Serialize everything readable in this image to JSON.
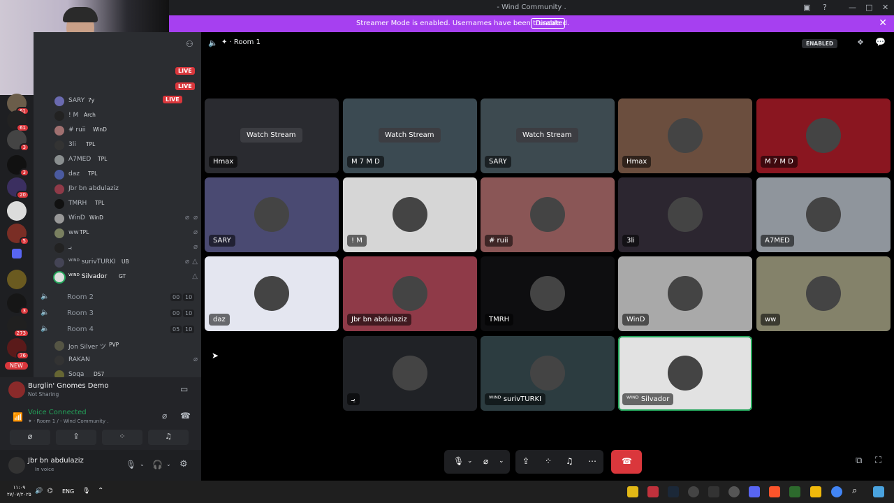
{
  "window": {
    "title": "- Wind Community .",
    "controls": [
      "—",
      "□",
      "✕"
    ]
  },
  "banner": {
    "message": "Streamer Mode is enabled. Usernames have been truncated.",
    "disable_label": "Disable",
    "close": "✕"
  },
  "servers": [
    {
      "badge": "61"
    },
    {
      "badge": "3"
    },
    {
      "badge": "3"
    },
    {
      "badge": "20"
    },
    {
      "badge": ""
    },
    {
      "badge": "5"
    },
    {
      "badge": ""
    },
    {
      "badge": ""
    },
    {
      "badge": "3"
    },
    {
      "badge": "273"
    },
    {
      "badge": "76"
    }
  ],
  "new_badge": "NEW",
  "sidebar": {
    "live_labels": [
      "LIVE",
      "LIVE",
      "LIVE"
    ],
    "room1_users": [
      {
        "name": "SARY",
        "tag": "7y",
        "icons": [
          "⌀",
          ""
        ],
        "live": true
      },
      {
        "name": "! M",
        "tag": "Arch",
        "icons": [
          "",
          ""
        ]
      },
      {
        "name": "# ruii",
        "tag": "WinD",
        "icons": [
          "",
          ""
        ]
      },
      {
        "name": "3li",
        "tag": "TPL",
        "icons": [
          "",
          ""
        ]
      },
      {
        "name": "A7MED",
        "tag": "TPL",
        "icons": [
          "",
          ""
        ]
      },
      {
        "name": "daz",
        "tag": "TPL",
        "icons": [
          "",
          ""
        ]
      },
      {
        "name": "Jbr bn abdulaziz",
        "tag": "",
        "icons": [
          "",
          ""
        ]
      },
      {
        "name": "TMRH",
        "tag": "TPL",
        "icons": [
          "",
          ""
        ]
      },
      {
        "name": "WinD",
        "tag": "WinD",
        "icons": [
          "⌀",
          "⌀"
        ]
      },
      {
        "name": "ww",
        "tag": "TPL",
        "icons": [
          "",
          "⌀"
        ]
      },
      {
        "name": "يـ",
        "tag": "",
        "icons": [
          "",
          "⌀"
        ]
      },
      {
        "name": "ᵂᴵᴺᴰ surivTURKI",
        "tag": "UB",
        "icons": [
          "⌀",
          "△"
        ]
      },
      {
        "name": "ᵂᴵᴺᴰ Silvador",
        "tag": "GT",
        "icons": [
          "",
          "△"
        ]
      }
    ],
    "rooms": [
      {
        "name": "Room 2",
        "count_a": "00",
        "count_b": "10"
      },
      {
        "name": "Room 3",
        "count_a": "00",
        "count_b": "10"
      },
      {
        "name": "Room 4",
        "count_a": "05",
        "count_b": "10"
      }
    ],
    "room4_users": [
      {
        "name": "Jon Silver ツ",
        "tag": "PVP"
      },
      {
        "name": "RAKAN",
        "tag": ""
      },
      {
        "name": "Soqa",
        "tag": "DS7"
      }
    ]
  },
  "activity": {
    "game": "Burglin' Gnomes Demo",
    "status": "Not Sharing",
    "voice_connected": "Voice Connected",
    "voice_location": "✦ · Room 1 / - Wind Community ."
  },
  "user": {
    "name": "Jbr bn abdulaziz",
    "status": "In voice"
  },
  "main": {
    "room_title": "✦ · Room 1",
    "enabled_badge": "ENABLED",
    "watch_label": "Watch Stream",
    "tiles": [
      {
        "label": "Hmax",
        "watch": true,
        "bg": "#2a2b30"
      },
      {
        "label": "M 7 M D",
        "watch": true,
        "bg": "#3b4a52"
      },
      {
        "label": "SARY",
        "watch": true,
        "bg": "#3d4a50"
      },
      {
        "label": "Hmax",
        "watch": false,
        "bg": "#6b4e3e"
      },
      {
        "label": "M 7 M D",
        "watch": false,
        "bg": "#8a1620"
      },
      {
        "label": "SARY",
        "watch": false,
        "bg": "#4a4a72"
      },
      {
        "label": "! M",
        "watch": false,
        "bg": "#d6d6d6"
      },
      {
        "label": "# ruii",
        "watch": false,
        "bg": "#8a5656"
      },
      {
        "label": "3li",
        "watch": false,
        "bg": "#2c2630"
      },
      {
        "label": "A7MED",
        "watch": false,
        "bg": "#8f959c"
      },
      {
        "label": "daz",
        "watch": false,
        "bg": "#e4e6f0"
      },
      {
        "label": "Jbr bn abdulaziz",
        "watch": false,
        "bg": "#8f3a48"
      },
      {
        "label": "TMRH",
        "watch": false,
        "bg": "#0e0e10"
      },
      {
        "label": "WinD",
        "watch": false,
        "bg": "#a9a9a9"
      },
      {
        "label": "ww",
        "watch": false,
        "bg": "#84826a"
      },
      {
        "label": "يـ",
        "watch": false,
        "bg": "#202226"
      },
      {
        "label": "ᵂᴵᴺᴰ surivTURKI",
        "watch": false,
        "bg": "#2c3c40"
      },
      {
        "label": "ᵂᴵᴺᴰ Silvador",
        "watch": false,
        "bg": "#e2e2e2",
        "speaking": true
      }
    ]
  },
  "taskbar": {
    "time": "١١:٠٩",
    "date": "٢٧/٠٧/٢٠٢٥",
    "lang": "ENG"
  },
  "colors": {
    "accent": "#a640f0",
    "live": "#da373c",
    "connected": "#23a55a",
    "hangup": "#da373c"
  }
}
